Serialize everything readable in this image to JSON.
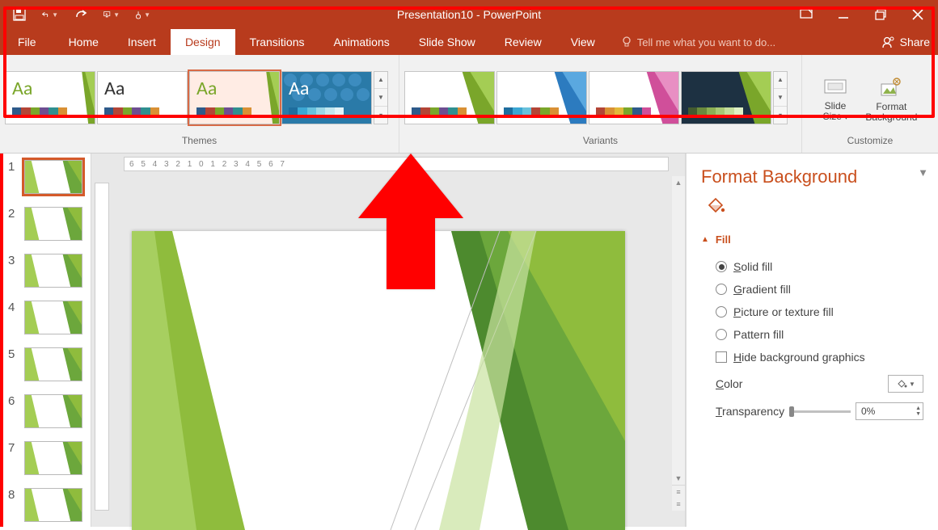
{
  "title": "Presentation10 - PowerPoint",
  "quick_access": [
    "save",
    "undo",
    "redo",
    "start-from-beginning",
    "touch-mode"
  ],
  "window_controls": [
    "ribbon-options",
    "minimize",
    "restore",
    "close"
  ],
  "tabs": {
    "items": [
      "File",
      "Home",
      "Insert",
      "Design",
      "Transitions",
      "Animations",
      "Slide Show",
      "Review",
      "View"
    ],
    "active": "Design",
    "tellme_placeholder": "Tell me what you want to do...",
    "share_label": "Share"
  },
  "ribbon": {
    "themes_label": "Themes",
    "variants_label": "Variants",
    "customize_label": "Customize",
    "slide_size_label": "Slide\nSize",
    "format_bg_label": "Format\nBackground",
    "themes": [
      {
        "aa": "Aa",
        "aa_color": "#7aa62a",
        "facet_colors": [
          "#7aa62a",
          "#a4cd54"
        ],
        "swatches": [
          "#2e5a8a",
          "#b34536",
          "#7aa62a",
          "#6d4e91",
          "#2f8f8f",
          "#d99034"
        ]
      },
      {
        "aa": "Aa",
        "aa_color": "#333333",
        "facet_colors": null,
        "swatches": [
          "#2e5a8a",
          "#b34536",
          "#7aa62a",
          "#6d4e91",
          "#2f8f8f",
          "#d99034"
        ]
      },
      {
        "aa": "Aa",
        "aa_color": "#7aa62a",
        "facet_colors": [
          "#7aa62a",
          "#a4cd54"
        ],
        "selected": true,
        "swatches": [
          "#2e5a8a",
          "#b34536",
          "#7aa62a",
          "#6d4e91",
          "#2f8f8f",
          "#d99034"
        ]
      },
      {
        "aa": "Aa",
        "aa_color": "#ffffff",
        "pattern": true,
        "swatches": [
          "#1e6d9e",
          "#3ca7d3",
          "#68c1dc",
          "#9bd7e6",
          "#c2e7ef",
          "#e2f3f8"
        ]
      }
    ],
    "variants": [
      {
        "facet_colors": [
          "#7aa62a",
          "#a4cd54"
        ],
        "swatches": [
          "#2e5a8a",
          "#b34536",
          "#7aa62a",
          "#6d4e91",
          "#2f8f8f",
          "#d99034"
        ]
      },
      {
        "facet_colors": [
          "#2c7bbf",
          "#5aa8e0"
        ],
        "swatches": [
          "#1e6d9e",
          "#3ca7d3",
          "#68c1dc",
          "#b34536",
          "#7aa62a",
          "#d99034"
        ]
      },
      {
        "facet_colors": [
          "#d04f9a",
          "#e88fc3"
        ],
        "swatches": [
          "#b34536",
          "#d99034",
          "#e2b93a",
          "#7aa62a",
          "#2e5a8a",
          "#d04f9a"
        ]
      },
      {
        "facet_colors": [
          "#7aa62a",
          "#a4cd54"
        ],
        "dark": true,
        "swatches": [
          "#435b2f",
          "#6a8a3d",
          "#8caf54",
          "#a8c874",
          "#c4dd9b",
          "#dff0c4"
        ]
      }
    ]
  },
  "ruler_text": "6          5          4          3          2          1          0          1          2          3          4          5          6          7",
  "thumbs": [
    1,
    2,
    3,
    4,
    5,
    6,
    7,
    8
  ],
  "selected_thumb": 1,
  "pane": {
    "title": "Format Background",
    "section": "Fill",
    "options": {
      "solid": "Solid fill",
      "gradient": "Gradient fill",
      "picture": "Picture or texture fill",
      "pattern": "Pattern fill",
      "hide": "Hide background graphics"
    },
    "selected_option": "solid",
    "color_label": "Color",
    "transparency_label": "Transparency",
    "transparency_value": "0%"
  }
}
